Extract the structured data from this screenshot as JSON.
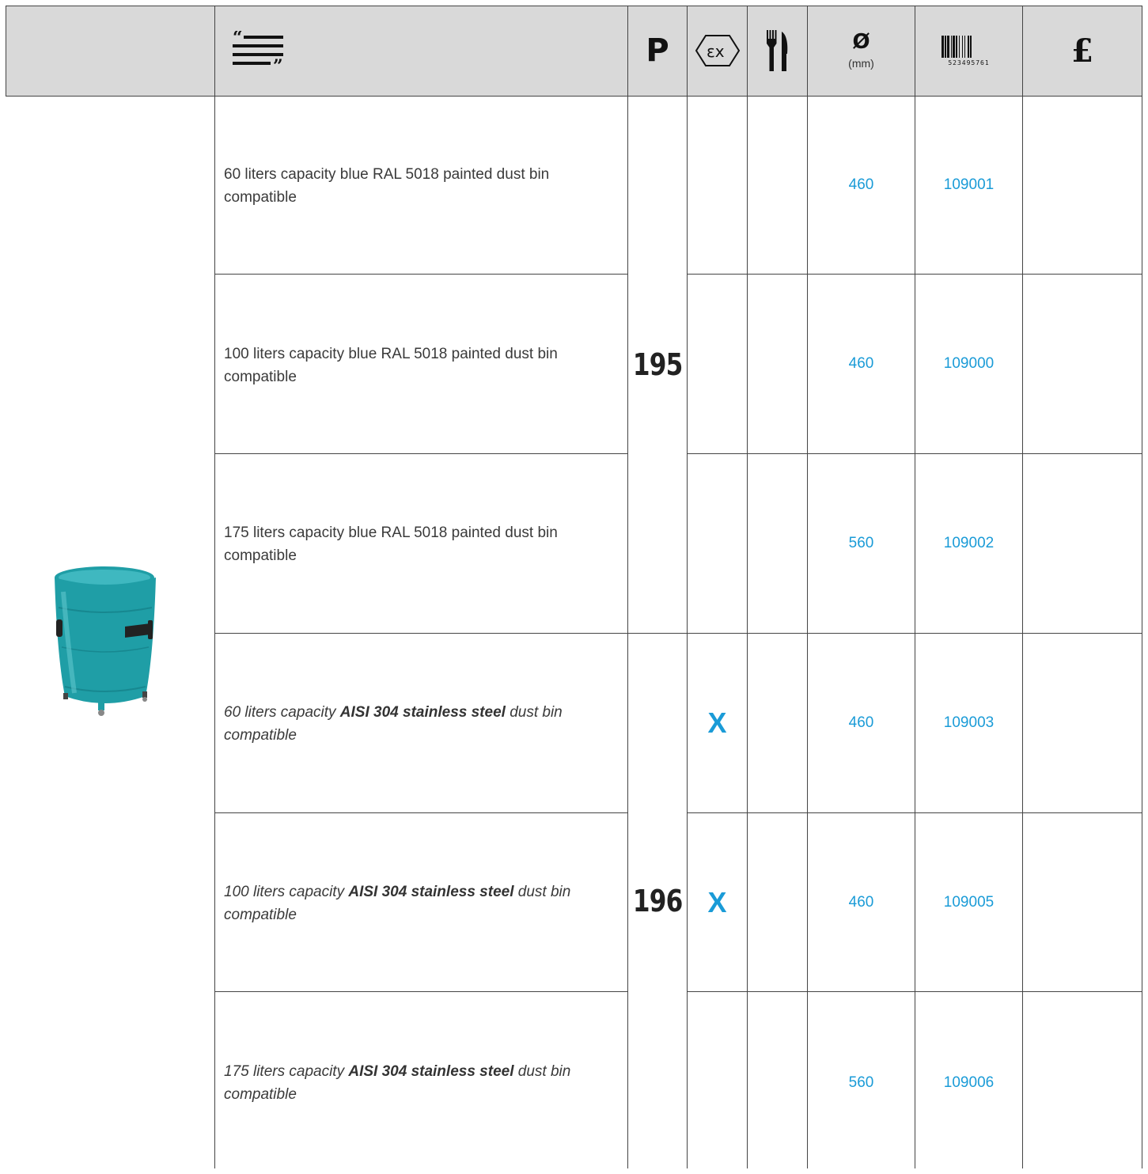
{
  "header": {
    "page_symbol": "P",
    "diameter_symbol": "Ø",
    "diameter_unit": "(mm)",
    "barcode_number": "523495761",
    "price_symbol": "£",
    "icons": {
      "description": "quote-lines-icon",
      "atex": "ex-hexagon-icon",
      "food": "fork-knife-icon",
      "barcode": "barcode-icon"
    }
  },
  "product_image": "teal-dust-bin-on-wheels",
  "groups": [
    {
      "page": "195"
    },
    {
      "page": "196"
    }
  ],
  "rows": [
    {
      "desc_pre": "60 liters capacity blue RAL 5018 painted dust bin compatible",
      "desc_bold": "",
      "desc_post": "",
      "atex": "",
      "diameter": "460",
      "code": "109001"
    },
    {
      "desc_pre": "100 liters capacity blue RAL 5018 painted dust bin compatible",
      "desc_bold": "",
      "desc_post": "",
      "atex": "",
      "diameter": "460",
      "code": "109000"
    },
    {
      "desc_pre": "175 liters capacity blue RAL 5018 painted dust bin compatible",
      "desc_bold": "",
      "desc_post": "",
      "atex": "",
      "diameter": "560",
      "code": "109002"
    },
    {
      "desc_pre": "60 liters capacity ",
      "desc_bold": "AISI 304 stainless steel",
      "desc_post": " dust bin compatible",
      "atex": "X",
      "diameter": "460",
      "code": "109003"
    },
    {
      "desc_pre": "100 liters capacity ",
      "desc_bold": "AISI 304 stainless steel",
      "desc_post": " dust bin compatible",
      "atex": "X",
      "diameter": "460",
      "code": "109005"
    },
    {
      "desc_pre": "175 liters capacity ",
      "desc_bold": "AISI 304 stainless steel",
      "desc_post": " dust bin compatible",
      "atex": "",
      "diameter": "560",
      "code": "109006"
    }
  ],
  "colors": {
    "accent": "#1a9bd7",
    "header_bg": "#d9d9d9",
    "bin": "#1f9ea6"
  }
}
